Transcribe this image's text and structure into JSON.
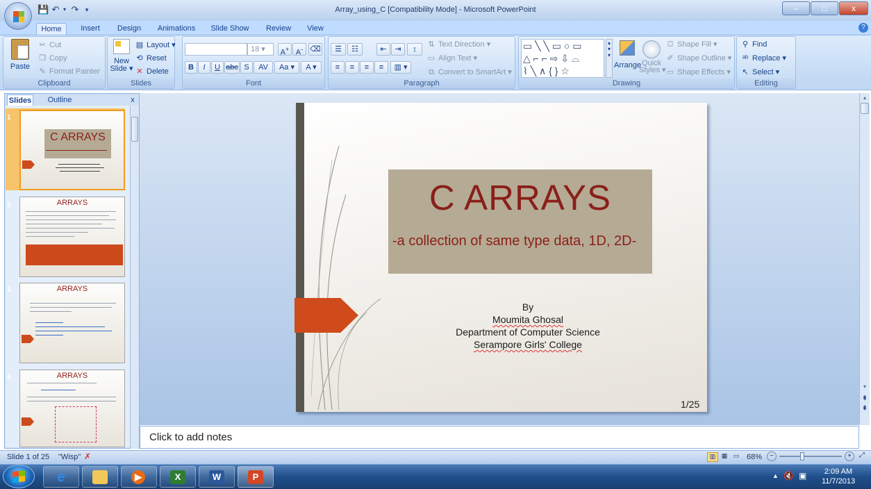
{
  "window": {
    "title": "Array_using_C [Compatibility Mode] - Microsoft PowerPoint",
    "minimize": "–",
    "maximize": "□",
    "close": "x"
  },
  "tabs": [
    "Home",
    "Insert",
    "Design",
    "Animations",
    "Slide Show",
    "Review",
    "View"
  ],
  "ribbon": {
    "clipboard": {
      "label": "Clipboard",
      "paste": "Paste",
      "cut": "Cut",
      "copy": "Copy",
      "format_painter": "Format Painter"
    },
    "slides": {
      "label": "Slides",
      "new_slide_line1": "New",
      "new_slide_line2": "Slide ▾",
      "layout": "Layout ▾",
      "reset": "Reset",
      "delete": "Delete"
    },
    "font": {
      "label": "Font",
      "size": "18"
    },
    "paragraph": {
      "label": "Paragraph",
      "text_direction": "Text Direction ▾",
      "align_text": "Align Text ▾",
      "convert_smartart": "Convert to SmartArt ▾"
    },
    "drawing": {
      "label": "Drawing",
      "arrange": "Arrange",
      "quick_styles_1": "Quick",
      "quick_styles_2": "Styles ▾",
      "shape_fill": "Shape Fill ▾",
      "shape_outline": "Shape Outline ▾",
      "shape_effects": "Shape Effects ▾"
    },
    "editing": {
      "label": "Editing",
      "find": "Find",
      "replace": "Replace ▾",
      "select": "Select ▾"
    }
  },
  "left_panel": {
    "tab_slides": "Slides",
    "tab_outline": "Outline",
    "close": "x",
    "thumbnails": [
      {
        "num": "1",
        "title": "C ARRAYS"
      },
      {
        "num": "2",
        "title": "ARRAYS"
      },
      {
        "num": "3",
        "title": "ARRAYS"
      },
      {
        "num": "4",
        "title": "ARRAYS"
      }
    ]
  },
  "slide": {
    "title": "C ARRAYS",
    "subtitle": "-a collection of same type data, 1D, 2D-",
    "by": "By",
    "author": "Moumita Ghosal",
    "department": "Department of Computer Science",
    "college": "Serampore Girls' College",
    "page": "1/25"
  },
  "notes_placeholder": "Click to add notes",
  "status": {
    "slide_info": "Slide 1 of 25",
    "theme": "\"Wisp\"",
    "zoom": "68%"
  },
  "clock": {
    "time": "2:09 AM",
    "date": "11/7/2013"
  },
  "colors": {
    "accent": "#cf4b1c",
    "title_red": "#8a1f1a",
    "title_box": "#b5ab94",
    "ribbon": "#c4dbf5"
  }
}
